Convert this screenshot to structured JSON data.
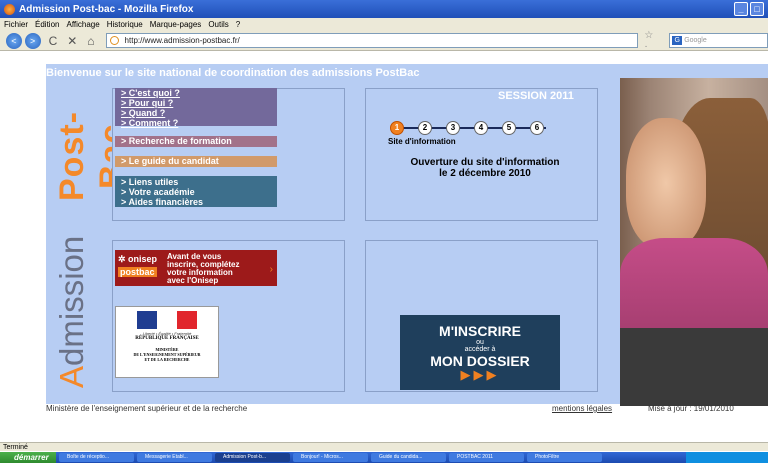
{
  "window": {
    "title": "Admission Post-bac - Mozilla Firefox",
    "buttons": [
      "_",
      "□"
    ]
  },
  "menubar": [
    "Fichier",
    "Édition",
    "Affichage",
    "Historique",
    "Marque-pages",
    "Outils",
    "?"
  ],
  "navbar": {
    "url": "http://www.admission-postbac.fr/",
    "search_placeholder": "Google",
    "back": "<",
    "forward": ">",
    "reload": "C",
    "stop": "✕",
    "home": "⌂",
    "star": "☆ ·"
  },
  "page": {
    "welcome": "Bienvenue sur le site national de coordination des admissions PostBac",
    "brand_post": "Post-Bac",
    "brand_admission_first": "A",
    "brand_admission_rest": "dmission",
    "menu1": [
      "C'est quoi ?",
      "Pour qui ?",
      "Quand ?",
      "Comment ?"
    ],
    "recherche": "> Recherche de formation",
    "guide": "> Le guide du candidat",
    "menu3": [
      "Liens utiles",
      "Votre académie",
      "Aides financières"
    ],
    "session": "SESSION 2011",
    "steps": [
      "1",
      "2",
      "3",
      "4",
      "5",
      "6"
    ],
    "step_caption": "Site d'information",
    "ouverture_line1": "Ouverture du site d'information",
    "ouverture_line2": "le 2 décembre 2010",
    "onisep": {
      "logo_top": "✲ onisep",
      "logo_bottom": "postbac",
      "message_lines": [
        "Avant de vous",
        "inscrire, complétez",
        "votre information",
        "avec l'Onisep"
      ],
      "arrow": "›"
    },
    "ministere": {
      "motto": "Liberté • Égalité • Fraternité",
      "republique": "RÉPUBLIQUE FRANÇAISE",
      "name_lines": [
        "MINISTÈRE",
        "DE L'ENSEIGNEMENT SUPÉRIEUR",
        "ET DE LA RECHERCHE"
      ]
    },
    "inscrire": {
      "line1": "M'INSCRIRE",
      "line2a": "ou",
      "line2b": "accéder à",
      "line3": "MON DOSSIER",
      "arrows": "▶▶▶"
    },
    "footer_ministere": "Ministère de l'enseignement supérieur et de la recherche",
    "footer_legal": "mentions légales",
    "footer_update": "Mise à jour : 19/01/2010"
  },
  "status": "Terminé",
  "taskbar": {
    "start": "démarrer",
    "tasks": [
      "Boîte de réceptio...",
      "Messagerie Etabl...",
      "Admission Post-b...",
      "Bonjour! - Micros...",
      "Guide du candida...",
      "POSTBAC 2011",
      "PhotoFiltre"
    ]
  }
}
